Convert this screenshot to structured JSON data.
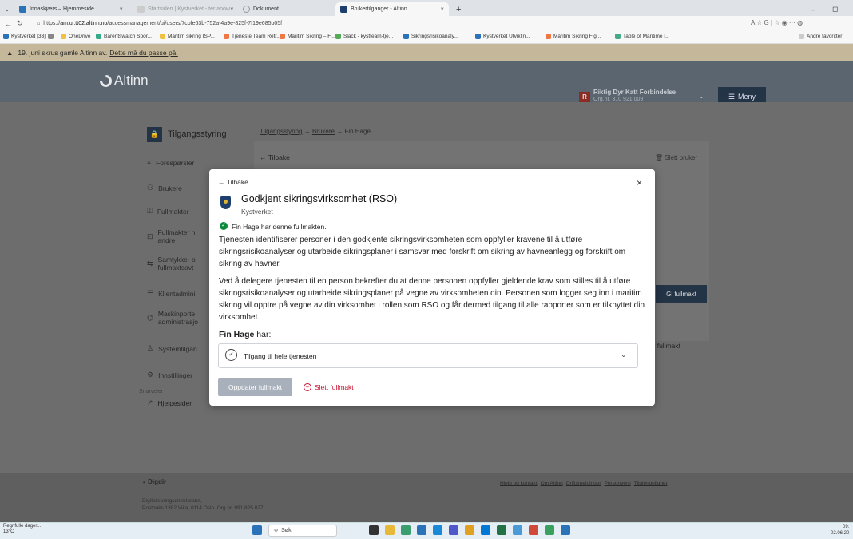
{
  "browser": {
    "tabs": [
      {
        "label": "Innaskjærs – Hjemmeside",
        "icon": "app-icon"
      },
      {
        "label": "Startsiden | Kystverket - ter anow",
        "icon": "page-icon"
      },
      {
        "label": "Dokument",
        "icon": "loading-icon"
      },
      {
        "label": "Brukertilganger - Altinn",
        "icon": "altinn-icon"
      }
    ],
    "url_prefix": "https://",
    "url_host": "am.ui.tt02.altinn.no",
    "url_path": "/accessmanagement/ui/users/7cbfe63b-752a-4a9e-825f-7f19e685b05f",
    "bookmarks": [
      "Kystverket [33]",
      "OneDrive",
      "Barentswatch Spor...",
      "Maritim sikring ISP...",
      "Tjeneste Team Retr...",
      "Maritim Sikring – F...",
      "Slack - kystteam-tje...",
      "Sikringsrisikoanaly...",
      "Kystverket Utviklin...",
      "Maritim Sikring Fig...",
      "Table of Maritime I...",
      "Andre favoritter"
    ]
  },
  "warning": {
    "text": "19. juni skrus gamle Altinn av.",
    "link": "Dette må du passe på."
  },
  "header": {
    "logo": "Altinn",
    "org_badge": "R",
    "org_name": "Riktig Dyr Katt Forbindelse",
    "org_nr": "Org.nr. 310 921 009",
    "menu_label": "Meny"
  },
  "sidebar": {
    "title": "Tilgangsstyring",
    "items": [
      {
        "label": "Forespørsler"
      },
      {
        "label": "Brukere"
      },
      {
        "label": "Fullmakter"
      },
      {
        "label": "Fullmakter h andre"
      },
      {
        "label": "Samtykke- o fullmaktsavt"
      },
      {
        "label": "Klientadmini"
      },
      {
        "label": "Maskinporte administrasjo"
      },
      {
        "label": "Systemtilgan"
      },
      {
        "label": "Innstillinger"
      }
    ],
    "snarveier": "Snarveier",
    "help": "Hjelpesider"
  },
  "breadcrumb": {
    "a": "Tilgangsstyring",
    "b": "Brukere",
    "c": "Fin Hage"
  },
  "main": {
    "back": "Tilbake",
    "delete_user": "Slett bruker",
    "grant": "Gi fullmakt",
    "grant2": "t fullmakt"
  },
  "modal": {
    "back": "Tilbake",
    "title": "Godkjent sikringsvirksomhet (RSO)",
    "provider": "Kystverket",
    "status": "Fin Hage har denne fullmakten.",
    "p1": "Tjenesten identifiserer personer i den godkjente sikringsvirksomheten som oppfyller kravene til å utføre sikringsrisikoanalyser og utarbeide sikringsplaner i samsvar med forskrift om sikring av havneanlegg og forskrift om sikring av havner.",
    "p2": "Ved å delegere tjenesten til en person bekrefter du at denne personen oppfyller gjeldende krav som stilles til å utføre sikringsrisikoanalyser og utarbeide sikringsplaner på vegne av virksomheten din. Personen som logger seg inn i maritim sikring vil opptre på vegne av din virksomhet i rollen som RSO og får dermed tilgang til alle rapporter som er tilknyttet din virksomhet.",
    "has_name": "Fin Hage",
    "has_suffix": "har:",
    "access": "Tilgang til hele tjenesten",
    "update": "Oppdater fullmakt",
    "delete": "Slett fullmakt"
  },
  "footer": {
    "brand": "Digdir",
    "addr1": "Digitaliseringsdirektoratet,",
    "addr2": "Postboks 1382 Vika, 0114 Oslo. Org.nr. 991 825 827",
    "links": [
      "Hjelp og kontakt",
      "Om Altinn",
      "Driftsmeldinger",
      "Personvern",
      "Tilgjengelighet"
    ]
  },
  "taskbar": {
    "weather1": "Regnfulle dager...",
    "weather2": "13°C",
    "search": "Søk",
    "time": "09:",
    "date": "02.06.20"
  },
  "colors": {
    "accent": "#243447",
    "danger": "#c8102e",
    "success": "#0a8a3a"
  }
}
